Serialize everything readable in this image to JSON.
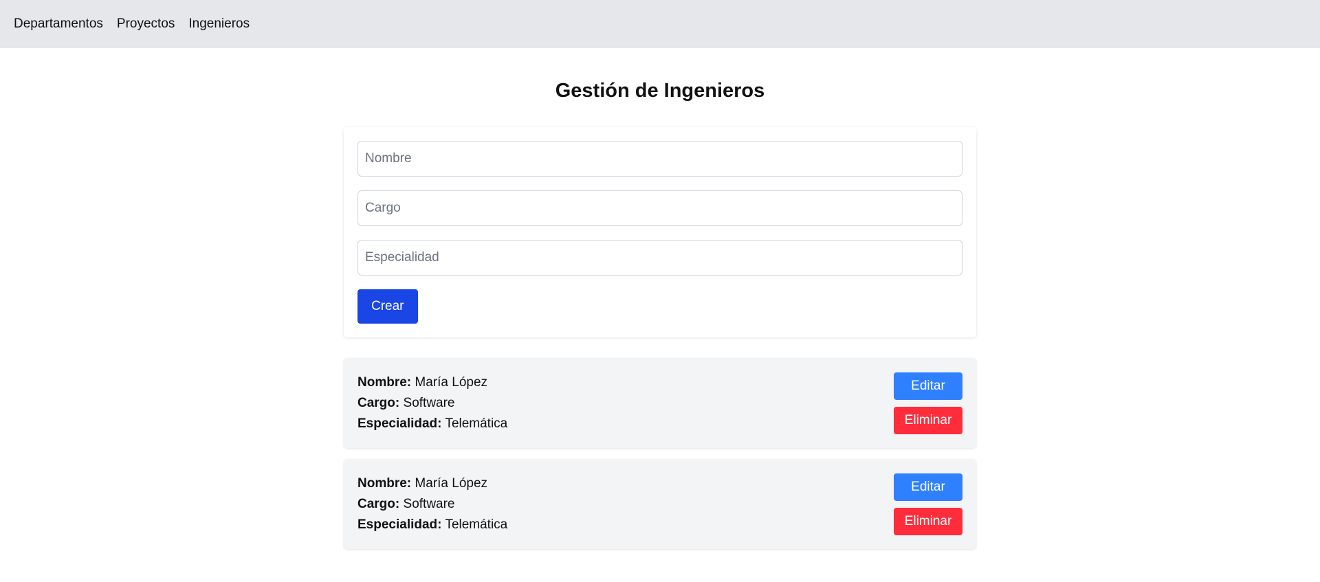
{
  "nav": {
    "items": [
      "Departamentos",
      "Proyectos",
      "Ingenieros"
    ]
  },
  "title": "Gestión de Ingenieros",
  "form": {
    "nombre_placeholder": "Nombre",
    "cargo_placeholder": "Cargo",
    "especialidad_placeholder": "Especialidad",
    "create_label": "Crear"
  },
  "labels": {
    "nombre": "Nombre:",
    "cargo": "Cargo:",
    "especialidad": "Especialidad:",
    "edit": "Editar",
    "delete": "Eliminar"
  },
  "engineers": [
    {
      "nombre": "María López",
      "cargo": "Software",
      "especialidad": "Telemática"
    },
    {
      "nombre": "María López",
      "cargo": "Software",
      "especialidad": "Telemática"
    }
  ]
}
